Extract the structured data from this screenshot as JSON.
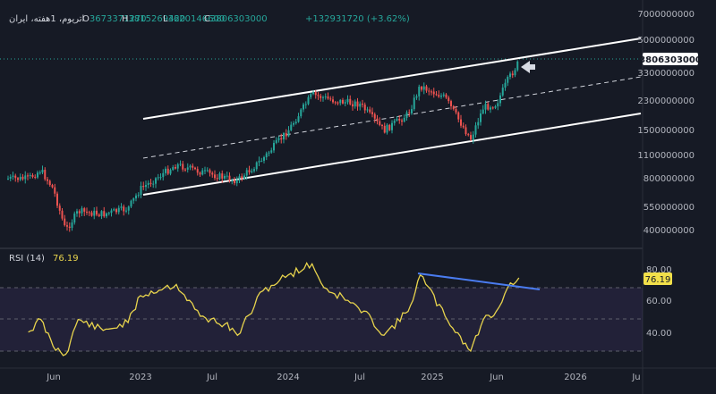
{
  "header": {
    "symbol": "اتریوم، 1هفته، ایران",
    "ohlc": [
      {
        "key": "O",
        "value": "3673371270"
      },
      {
        "key": "H",
        "value": "3815269420"
      },
      {
        "key": "L",
        "value": "3620146600"
      },
      {
        "key": "C",
        "value": "3806303000"
      }
    ],
    "change": "+132931720 (+3.62%)"
  },
  "price_axis": {
    "ticks": [
      "7000000000",
      "5000000000",
      "3300000000",
      "2300000000",
      "1500000000",
      "1100000000",
      "800000000",
      "550000000",
      "400000000"
    ],
    "current_label": "3806303000"
  },
  "rsi": {
    "label": "RSI (14)",
    "value": "76.19",
    "ticks": [
      "80.00",
      "60.00",
      "40.00"
    ]
  },
  "time_axis": [
    "Jun",
    "2023",
    "Jul",
    "2024",
    "Jul",
    "2025",
    "Jun",
    "2026",
    "Ju"
  ],
  "colors": {
    "background": "#161a25",
    "up": "#26a69a",
    "down": "#ef5350",
    "rsi_line": "#e8d44d",
    "rsi_band": "rgba(126,87,194,0.12)",
    "trendline": "#4a7cf0",
    "channel": "#ffffff",
    "badge_bg": "#ffffff",
    "rsi_badge_bg": "#f2e04a"
  },
  "chart_data": [
    {
      "type": "candlestick",
      "title": "اتریوم، 1هفته، ایران",
      "scale": "log",
      "x_range": [
        "2022-04",
        "2026-07"
      ],
      "y_range": [
        330000000,
        8000000000
      ],
      "ohlc_last": {
        "open": 3673371270,
        "high": 3815269420,
        "low": 3620146600,
        "close": 3806303000
      },
      "close_series_approx": [
        {
          "x": "2022-04",
          "y": 800000000
        },
        {
          "x": "2022-05",
          "y": 900000000
        },
        {
          "x": "2022-06",
          "y": 700000000
        },
        {
          "x": "2022-07",
          "y": 400000000
        },
        {
          "x": "2022-08",
          "y": 520000000
        },
        {
          "x": "2022-10",
          "y": 500000000
        },
        {
          "x": "2022-12",
          "y": 540000000
        },
        {
          "x": "2023-01",
          "y": 700000000
        },
        {
          "x": "2023-04",
          "y": 970000000
        },
        {
          "x": "2023-06",
          "y": 880000000
        },
        {
          "x": "2023-09",
          "y": 780000000
        },
        {
          "x": "2023-11",
          "y": 1050000000
        },
        {
          "x": "2024-01",
          "y": 1500000000
        },
        {
          "x": "2024-03",
          "y": 2500000000
        },
        {
          "x": "2024-05",
          "y": 2300000000
        },
        {
          "x": "2024-07",
          "y": 2200000000
        },
        {
          "x": "2024-09",
          "y": 1500000000
        },
        {
          "x": "2024-11",
          "y": 1900000000
        },
        {
          "x": "2024-12",
          "y": 2800000000
        },
        {
          "x": "2025-02",
          "y": 2400000000
        },
        {
          "x": "2025-04",
          "y": 1350000000
        },
        {
          "x": "2025-05",
          "y": 2100000000
        },
        {
          "x": "2025-06",
          "y": 2200000000
        },
        {
          "x": "2025-07",
          "y": 3000000000
        },
        {
          "x": "2025-08",
          "y": 3806303000
        }
      ],
      "channel": {
        "upper": [
          {
            "x": "2023-01",
            "y": 1800000000
          },
          {
            "x": "2026-07",
            "y": 5000000000
          }
        ],
        "lower": [
          {
            "x": "2023-01",
            "y": 620000000
          },
          {
            "x": "2026-07",
            "y": 1800000000
          }
        ],
        "middle": [
          {
            "x": "2023-01",
            "y": 1050000000
          },
          {
            "x": "2026-07",
            "y": 2900000000
          }
        ]
      }
    },
    {
      "type": "line",
      "title": "RSI (14)",
      "y_range": [
        25,
        90
      ],
      "reference_levels": [
        70,
        50,
        30
      ],
      "current": 76.19,
      "series_approx": [
        {
          "x": "2022-04",
          "y": 42
        },
        {
          "x": "2022-05",
          "y": 50
        },
        {
          "x": "2022-06",
          "y": 33
        },
        {
          "x": "2022-07",
          "y": 28
        },
        {
          "x": "2022-08",
          "y": 50
        },
        {
          "x": "2022-10",
          "y": 43
        },
        {
          "x": "2022-12",
          "y": 48
        },
        {
          "x": "2023-01",
          "y": 65
        },
        {
          "x": "2023-03",
          "y": 70
        },
        {
          "x": "2023-04",
          "y": 72
        },
        {
          "x": "2023-06",
          "y": 52
        },
        {
          "x": "2023-08",
          "y": 47
        },
        {
          "x": "2023-09",
          "y": 40
        },
        {
          "x": "2023-11",
          "y": 68
        },
        {
          "x": "2024-01",
          "y": 78
        },
        {
          "x": "2024-03",
          "y": 85
        },
        {
          "x": "2024-04",
          "y": 70
        },
        {
          "x": "2024-06",
          "y": 62
        },
        {
          "x": "2024-08",
          "y": 50
        },
        {
          "x": "2024-09",
          "y": 40
        },
        {
          "x": "2024-11",
          "y": 55
        },
        {
          "x": "2024-12",
          "y": 78
        },
        {
          "x": "2025-02",
          "y": 52
        },
        {
          "x": "2025-04",
          "y": 30
        },
        {
          "x": "2025-05",
          "y": 50
        },
        {
          "x": "2025-06",
          "y": 55
        },
        {
          "x": "2025-07",
          "y": 70
        },
        {
          "x": "2025-08",
          "y": 76.19
        }
      ],
      "trendline": [
        {
          "x": "2024-12",
          "y": 78
        },
        {
          "x": "2025-10",
          "y": 69
        }
      ]
    }
  ]
}
